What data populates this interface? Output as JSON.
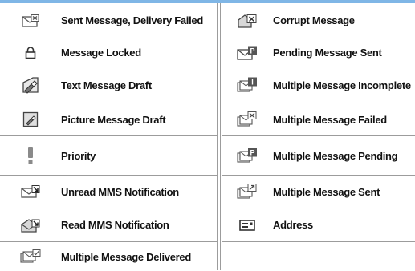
{
  "left_column": [
    {
      "icon": "sent-failed-envelope-icon",
      "label": "Sent Message, Delivery Failed"
    },
    {
      "icon": "lock-icon",
      "label": "Message Locked"
    },
    {
      "icon": "text-draft-icon",
      "label": "Text Message Draft"
    },
    {
      "icon": "picture-draft-icon",
      "label": "Picture Message Draft"
    },
    {
      "icon": "priority-icon",
      "label": "Priority"
    },
    {
      "icon": "unread-mms-icon",
      "label": "Unread MMS Notification"
    },
    {
      "icon": "read-mms-icon",
      "label": "Read MMS Notification"
    },
    {
      "icon": "multiple-delivered-icon",
      "label": "Multiple Message Delivered"
    }
  ],
  "right_column": [
    {
      "icon": "corrupt-message-icon",
      "label": "Corrupt Message"
    },
    {
      "icon": "pending-sent-icon",
      "label": "Pending Message Sent"
    },
    {
      "icon": "multiple-incomplete-icon",
      "label": "Multiple Message Incomplete"
    },
    {
      "icon": "multiple-failed-icon",
      "label": "Multiple Message Failed"
    },
    {
      "icon": "multiple-pending-icon",
      "label": "Multiple Message Pending"
    },
    {
      "icon": "multiple-sent-icon",
      "label": "Multiple Message Sent"
    },
    {
      "icon": "address-icon",
      "label": "Address"
    }
  ],
  "colors": {
    "header_band": "#7fb6e6",
    "rule": "#9c9c9c",
    "icon": "#555555"
  }
}
